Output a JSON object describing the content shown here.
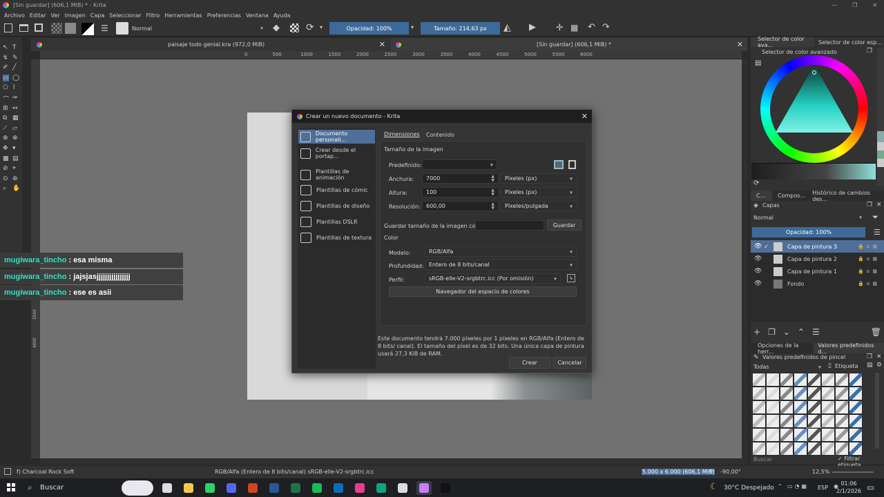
{
  "window": {
    "title": "[Sin guardar]  (606,1 MiB) * - Krita"
  },
  "menu": [
    "Archivo",
    "Editar",
    "Ver",
    "Imagen",
    "Capa",
    "Seleccionar",
    "Filtro",
    "Herramientas",
    "Preferencias",
    "Ventana",
    "Ayuda"
  ],
  "toolbar": {
    "blend_mode": "Normal",
    "opacity": "Opacidad: 100%",
    "size": "Tamaño: 214,63 px"
  },
  "tabs": [
    {
      "label": "paisaje todo genial.kra (972,0 MiB)"
    },
    {
      "label": "[Sin guardar]  (606,1 MiB) *"
    }
  ],
  "ruler": [
    "0",
    "500",
    "1000",
    "1500",
    "2000",
    "2500",
    "3000",
    "3500",
    "4000",
    "4500",
    "5000",
    "5500",
    "6000"
  ],
  "vruler": [
    "3500",
    "4000"
  ],
  "chat": [
    {
      "user": "mugiwara_tincho",
      "msg": ": esa misma"
    },
    {
      "user": "mugiwara_tincho",
      "msg": ": jajsjasjjjjjjjjjjjjjjjj"
    },
    {
      "user": "mugiwara_tincho",
      "msg": ": ese es asii"
    }
  ],
  "dialog": {
    "title": "Crear un nuevo documento - Krita",
    "sidebar": [
      {
        "label": "Documento personali...",
        "icon": "document-icon"
      },
      {
        "label": "Crear desde el portap...",
        "icon": "clipboard-icon"
      },
      {
        "label": "Plantillas de animación",
        "icon": "animation-icon"
      },
      {
        "label": "Plantillas de cómic",
        "icon": "comic-icon"
      },
      {
        "label": "Plantillas de diseño",
        "icon": "design-icon"
      },
      {
        "label": "Plantillas DSLR",
        "icon": "camera-icon"
      },
      {
        "label": "Plantillas de textura",
        "icon": "texture-icon"
      }
    ],
    "tab_dimensions": "Dimensiones",
    "tab_content": "Contenido",
    "image_size_title": "Tamaño de la imagen",
    "preset_label": "Predefinido:",
    "preset_value": "",
    "width_label": "Anchura:",
    "width_value": "7000",
    "width_unit": "Píxeles (px)",
    "height_label": "Altura:",
    "height_value": "100",
    "height_unit": "Píxeles (px)",
    "resolution_label": "Resolución:",
    "resolution_value": "600,00",
    "resolution_unit": "Píxeles/pulgada",
    "save_size_label": "Guardar tamaño de la imagen como:",
    "save_size_value": "",
    "save_button": "Guardar",
    "color_title": "Color",
    "model_label": "Modelo:",
    "model_value": "RGB/Alfa",
    "depth_label": "Profundidad:",
    "depth_value": "Entero de 8 bits/canal",
    "profile_label": "Perfil:",
    "profile_value": "sRGB-elle-V2-srgbtrc.icc (Por omisión)",
    "colorspace_button": "Navegador del espacio de colores",
    "info": "Este documento tendrá 7.000 píxeles por 1 píxeles en RGB/Alfa (Entero de 8 bits/ canal). El tamaño del píxel es de 32 bits. Una única capa de pintura usará 27,3 KiB de RAM.",
    "create_button": "Crear",
    "cancel_button": "Cancelar"
  },
  "right": {
    "color_tabs": [
      "Selector de color ava...",
      "Selector de color esp..."
    ],
    "color_title": "Selector de color avanzado",
    "layer_tabs": [
      "C...",
      "Compos...",
      "Histórico de cambios des..."
    ],
    "layers_title": "Capas",
    "layers_mode": "Normal",
    "layers_opacity": "Opacidad:  100%",
    "layers": [
      "Capa de pintura 3",
      "Capa de pintura 2",
      "Capa de pintura 1",
      "Fondo"
    ],
    "brush_tabs": [
      "Opciones de la herr...",
      "Valores predefinidos d..."
    ],
    "brush_title": "Valores predefinidos de pincel",
    "brush_filter": "Todas",
    "brush_tag": "Etiqueta",
    "search_placeholder": "Buscar",
    "filter_tag": "Filtrar etiqueta"
  },
  "status": {
    "brush": "f) Charcoal Rock Soft",
    "color": "RGB/Alfa (Entero de 8 bits/canal)  sRGB-elle-V2-srgbtrc.icc",
    "dims": "5.000 x 6.000 (606,1 MiB)",
    "angle": "-90,00°",
    "zoom": "12,5%"
  },
  "taskbar": {
    "search": "Buscar",
    "weather": "30°C  Despejado",
    "lang": "ESP",
    "time": "01:06",
    "date": "2/1/2026"
  },
  "colors": {
    "accent": "#3d6a99",
    "chat_user": "#2ee2c6"
  }
}
